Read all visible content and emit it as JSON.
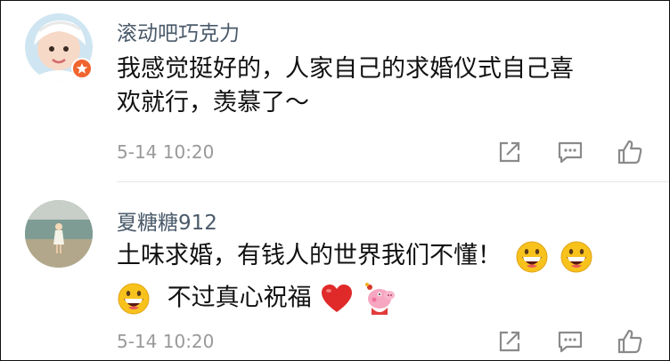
{
  "comments": [
    {
      "username": "滚动吧巧克力",
      "lines": [
        "我感觉挺好的，人家自己的求婚仪式自己喜",
        "欢就行，羡慕了～"
      ],
      "time": "5-14 10:20",
      "avatar_icon": "girl-avatar",
      "badge_icon": "star-badge-icon",
      "badge_color": "#f0642e"
    },
    {
      "username": "夏糖糖912",
      "line1": "土味求婚，有钱人的世界我们不懂！",
      "line2": "不过真心祝福",
      "time": "5-14 10:20",
      "avatar_icon": "beach-photo-avatar",
      "line1_emojis": [
        "grinning-face",
        "grinning-face"
      ],
      "line2_emojis_before": [
        "grinning-face"
      ],
      "line2_emojis_after": [
        "red-heart",
        "peppa-pig"
      ]
    }
  ],
  "actions": [
    "share-icon",
    "comment-icon",
    "like-icon"
  ],
  "colors": {
    "username": "#4a5a6a",
    "time": "#999999",
    "text": "#111111",
    "icon": "#8a8a8a"
  }
}
